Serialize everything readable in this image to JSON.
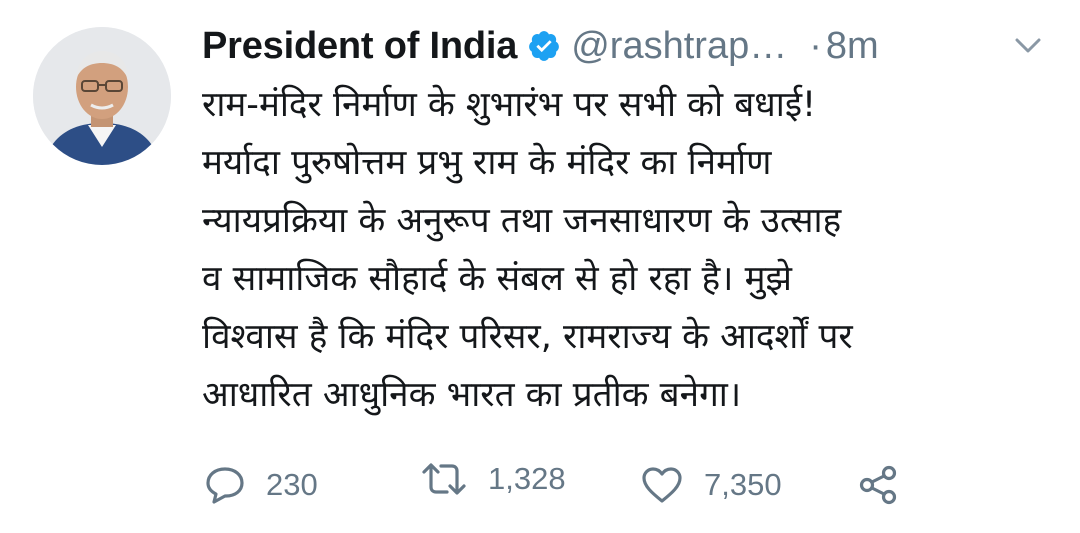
{
  "tweet": {
    "author_name": "President of India",
    "handle": "@rashtrap…",
    "separator": "·",
    "time": "8m",
    "lines": [
      "राम-मंदिर निर्माण के शुभारंभ पर सभी को बधाई!",
      "मर्यादा पुरुषोत्तम प्रभु राम के मंदिर का निर्माण",
      "न्यायप्रक्रिया के अनुरूप तथा जनसाधारण के उत्साह",
      "व सामाजिक सौहार्द के संबल से हो रहा है। मुझे",
      "विश्वास है कि मंदिर परिसर, रामराज्य के आदर्शों पर",
      "आधारित आधुनिक भारत का प्रतीक बनेगा।"
    ],
    "replies": "230",
    "retweets": "1,328",
    "likes": "7,350"
  },
  "icons": {
    "avatar": "avatar",
    "verified": "verified-badge-icon",
    "more": "chevron-down-icon",
    "reply": "reply-icon",
    "retweet": "retweet-icon",
    "like": "heart-icon",
    "share": "share-icon"
  },
  "colors": {
    "verified": "#1da1f2",
    "secondary_text": "#657786",
    "primary_text": "#14171a"
  }
}
